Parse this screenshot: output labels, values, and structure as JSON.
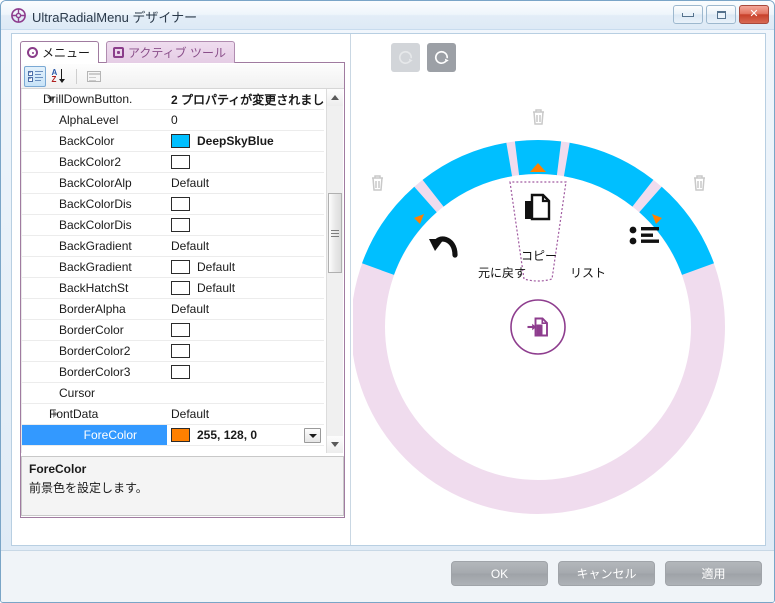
{
  "window": {
    "title": "UltraRadialMenu デザイナー",
    "icon": "radial-menu-icon",
    "minimize_label": "",
    "maximize_label": "",
    "close_label": "✕"
  },
  "tabs": [
    {
      "label": "メニュー",
      "icon": "radial-dot-icon",
      "selected": true
    },
    {
      "label": "アクティブ ツール",
      "icon": "square-dot-icon",
      "selected": false
    }
  ],
  "propertygrid": {
    "toolbar": [
      {
        "name": "categorized-view-button",
        "icon": "categorized-icon",
        "active": true
      },
      {
        "name": "alphabetical-sort-button",
        "icon": "sort-az-icon",
        "active": false
      },
      {
        "name": "property-pages-button",
        "icon": "property-pages-icon",
        "active": false,
        "disabled": true
      }
    ],
    "rows": [
      {
        "name": "DrillDownButton.",
        "value": "2 プロパティが変更されまし",
        "type": "header",
        "expander": "open",
        "bold": true
      },
      {
        "name": "AlphaLevel",
        "value": "0",
        "type": "text"
      },
      {
        "name": "BackColor",
        "value": "DeepSkyBlue",
        "type": "color",
        "swatch": "#00bfff",
        "bold": true
      },
      {
        "name": "BackColor2",
        "value": "",
        "type": "color",
        "swatch": "#ffffff"
      },
      {
        "name": "BackColorAlp",
        "value": "Default",
        "type": "text"
      },
      {
        "name": "BackColorDis",
        "value": "",
        "type": "color",
        "swatch": "#ffffff"
      },
      {
        "name": "BackColorDis",
        "value": "",
        "type": "color",
        "swatch": "#ffffff"
      },
      {
        "name": "BackGradient",
        "value": "Default",
        "type": "text"
      },
      {
        "name": "BackGradient",
        "value": "Default",
        "type": "color",
        "swatch": "#ffffff"
      },
      {
        "name": "BackHatchSt",
        "value": "Default",
        "type": "color",
        "swatch": "#ffffff"
      },
      {
        "name": "BorderAlpha",
        "value": "Default",
        "type": "text"
      },
      {
        "name": "BorderColor",
        "value": "",
        "type": "color",
        "swatch": "#ffffff"
      },
      {
        "name": "BorderColor2",
        "value": "",
        "type": "color",
        "swatch": "#ffffff"
      },
      {
        "name": "BorderColor3",
        "value": "",
        "type": "color",
        "swatch": "#ffffff"
      },
      {
        "name": "Cursor",
        "value": "",
        "type": "text"
      },
      {
        "name": "FontData",
        "value": "Default",
        "type": "text",
        "expander": "closed"
      },
      {
        "name": "ForeColor",
        "value": "255, 128, 0",
        "type": "color",
        "swatch": "#ff8000",
        "selected": true,
        "bold": true,
        "dropdown": true
      }
    ],
    "scrollbar": {
      "up": "▲",
      "down": "▼"
    }
  },
  "description": {
    "title": "ForeColor",
    "text": "前景色を設定します。"
  },
  "preview": {
    "toolbar": [
      {
        "name": "rotate-ccw-button",
        "icon": "rotate-icon",
        "enabled": false
      },
      {
        "name": "rotate-cw-button",
        "icon": "rotate-icon",
        "enabled": true
      }
    ],
    "radial": {
      "ring_active_color": "#00bfff",
      "ring_inactive_color": "#f0dcee",
      "accent_color": "#ff8000",
      "center_color": "#8e3d8e",
      "items": [
        {
          "label": "元に戻す",
          "icon": "undo-icon"
        },
        {
          "label": "コピー",
          "icon": "copy-icon",
          "selected": true
        },
        {
          "label": "リスト",
          "icon": "list-icon"
        }
      ],
      "center_item": {
        "icon": "import-document-icon"
      },
      "delete_handles": 3,
      "rotate_handles": 3
    }
  },
  "footer": {
    "buttons": [
      {
        "label": "OK",
        "name": "ok-button"
      },
      {
        "label": "キャンセル",
        "name": "cancel-button"
      },
      {
        "label": "適用",
        "name": "apply-button"
      }
    ]
  }
}
